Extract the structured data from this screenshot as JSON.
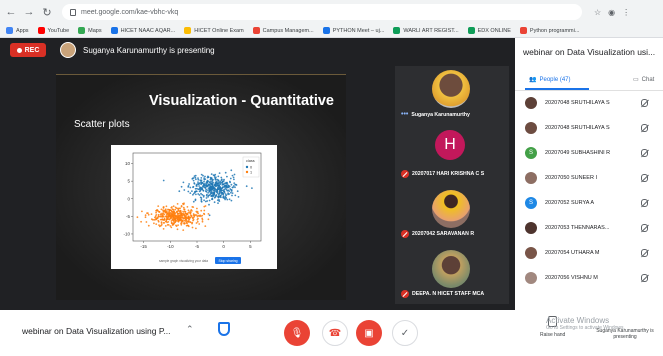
{
  "browser": {
    "url": "meet.google.com/kae-vbhc-vkq",
    "bookmarks": [
      {
        "label": "Apps",
        "color": "#4285f4"
      },
      {
        "label": "YouTube",
        "color": "#ff0000"
      },
      {
        "label": "Maps",
        "color": "#34a853"
      },
      {
        "label": "HICET NAAC AQAR...",
        "color": "#1a73e8"
      },
      {
        "label": "HICET Online Exam",
        "color": "#fbbc04"
      },
      {
        "label": "Campus Managem...",
        "color": "#ea4335"
      },
      {
        "label": "PYTHON Meet – uj...",
        "color": "#1a73e8"
      },
      {
        "label": "WARLI ART REGIST...",
        "color": "#0f9d58"
      },
      {
        "label": "EDX ONLINE",
        "color": "#0f9d58"
      },
      {
        "label": "Python programmi...",
        "color": "#ea4335"
      }
    ]
  },
  "stage": {
    "rec_label": "REC",
    "presenter_text": "Suganya Karunamurthy is presenting"
  },
  "slide": {
    "title": "Visualization - Quantitative",
    "subtitle": "Scatter plots"
  },
  "chart_data": {
    "type": "scatter",
    "legend_title": "class",
    "legend": [
      "0",
      "1"
    ],
    "x_ticks": [
      "-15",
      "-10",
      "-5",
      "0",
      "5"
    ],
    "y_ticks": [
      "10",
      "5",
      "0",
      "-5",
      "-10"
    ],
    "xlim": [
      -17,
      7
    ],
    "ylim": [
      -12,
      13
    ],
    "series": [
      {
        "name": "0",
        "color": "#1f77b4",
        "center": [
          -2,
          3
        ],
        "spread": [
          4,
          3.2
        ]
      },
      {
        "name": "1",
        "color": "#ff7f0e",
        "center": [
          -9,
          -5
        ],
        "spread": [
          4,
          2.6
        ]
      }
    ],
    "caption": "sample graph visualizing your data",
    "button_label": "Stop sharing"
  },
  "tiles": [
    {
      "name": "Suganya Karunamurthy",
      "muted": false
    },
    {
      "name": "20207017 HARI KRISHNA C S",
      "muted": true,
      "initial": "H"
    },
    {
      "name": "20207042 SARAVANAN R",
      "muted": true
    },
    {
      "name": "DEEPA. N HICET STAFF MCA",
      "muted": true
    }
  ],
  "panel": {
    "title": "webinar on Data Visualization usi...",
    "people_tab": "People (47)",
    "chat_tab": "Chat",
    "participants": [
      {
        "name": "20207048 SRUTHILAYA S",
        "color": "#5d4037"
      },
      {
        "name": "20207048 SRUTHILAYA S",
        "color": "#6d4c41"
      },
      {
        "name": "20207049 SUBHASHINI R",
        "color": "#43a047",
        "initial": "S"
      },
      {
        "name": "20207050 SUNEER I",
        "color": "#8d6e63"
      },
      {
        "name": "20207052 SURYA A",
        "color": "#1e88e5",
        "initial": "S"
      },
      {
        "name": "20207053 THENNARAS...",
        "color": "#4e342e"
      },
      {
        "name": "20207054 UTHARA M",
        "color": "#795548"
      },
      {
        "name": "20207056 VISHNU M",
        "color": "#a1887f"
      }
    ]
  },
  "bottom": {
    "meeting_title": "webinar on Data Visualization using P...",
    "watermark_line1": "Activate Windows",
    "watermark_line2": "Go to Settings to activate Windows.",
    "raise_hand": "Raise hand",
    "presenting_label": "Suganya Karunamurthy is presenting"
  }
}
